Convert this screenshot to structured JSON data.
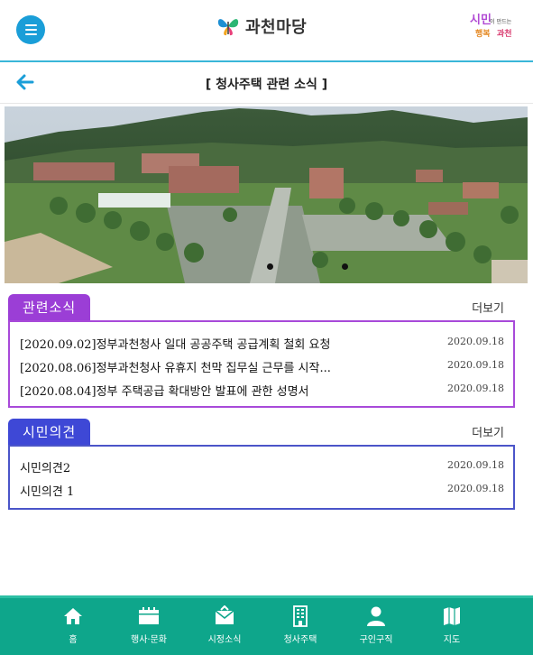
{
  "header": {
    "menu_icon": "hamburger-menu-icon",
    "logo_text": "과천마당",
    "slogan_line1": "시민",
    "slogan_line1_small": "이 만드는",
    "slogan_line2": "행복",
    "slogan_line2_end": "과천"
  },
  "subheader": {
    "back_icon": "arrow-left-icon",
    "title": "[ 청사주택 관련 소식 ]"
  },
  "sections": {
    "news": {
      "tab_label": "관련소식",
      "more_label": "더보기",
      "color": "#9b3ed6",
      "items": [
        {
          "title": "[2020.09.02]정부과천청사 일대 공공주택 공급계획 철회 요청",
          "date": "2020.09.18"
        },
        {
          "title": "[2020.08.06]정부과천청사 유휴지 천막 집무실 근무를 시작...",
          "date": "2020.09.18"
        },
        {
          "title": "[2020.08.04]정부 주택공급 확대방안 발표에 관한 성명서",
          "date": "2020.09.18"
        }
      ]
    },
    "opinion": {
      "tab_label": "시민의견",
      "more_label": "더보기",
      "color": "#3e48d6",
      "items": [
        {
          "title": "시민의견2",
          "date": "2020.09.18"
        },
        {
          "title": "시민의견 1",
          "date": "2020.09.18"
        }
      ]
    }
  },
  "bottom_nav": [
    {
      "label": "홈",
      "icon": "home-icon"
    },
    {
      "label": "행사·문화",
      "icon": "calendar-icon"
    },
    {
      "label": "시정소식",
      "icon": "mail-icon"
    },
    {
      "label": "청사주택",
      "icon": "building-icon"
    },
    {
      "label": "구인구직",
      "icon": "person-icon"
    },
    {
      "label": "지도",
      "icon": "map-icon"
    }
  ],
  "colors": {
    "accent_blue": "#1a9ed8",
    "nav_green": "#0ea68b"
  }
}
